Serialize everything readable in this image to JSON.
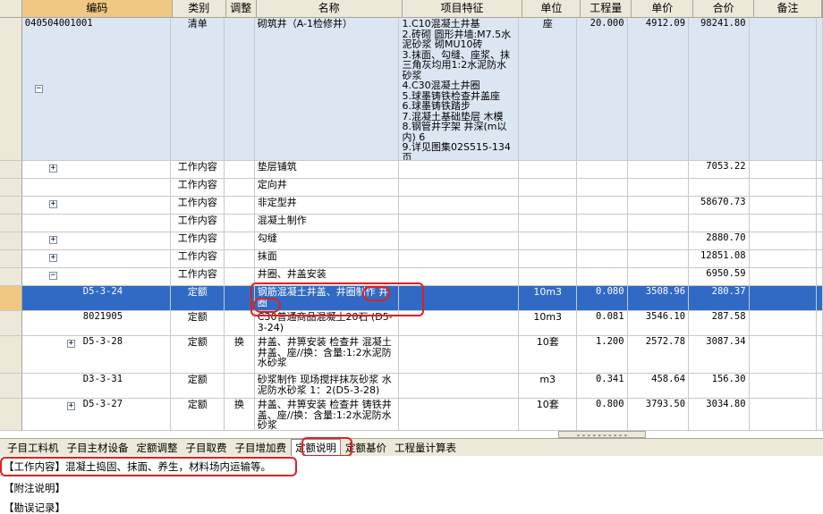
{
  "columns": {
    "code": "编码",
    "type": "类别",
    "adjust": "调整",
    "name": "名称",
    "features": "项目特征",
    "unit": "单位",
    "quantity": "工程量",
    "price": "单价",
    "total": "合价",
    "note": "备注"
  },
  "rows": [
    {
      "code": "040504001001",
      "type": "清单",
      "adjust": "",
      "name": "砌筑井（A-1检修井）",
      "features": "1.C10混凝土井基\n2.砖砌 圆形井墙:M7.5水泥砂浆 砌MU10砖\n3.抹面、勾缝、座浆、抹三角灰均用1:2水泥防水砂浆\n4.C30混凝土井圈\n5.球墨铸铁检查井盖座\n6.球墨铸铁踏步\n7.混凝土基础垫层 木模\n8.钢管井字架 井深(m以内) 6\n9.详见图集02S515-134页",
      "unit": "座",
      "quantity": "20.000",
      "price": "4912.09",
      "total": "98241.80",
      "expander": "−"
    },
    {
      "code": "",
      "type": "工作内容",
      "adjust": "",
      "name": "垫层铺筑",
      "features": "",
      "unit": "",
      "quantity": "",
      "price": "",
      "total": "7053.22",
      "expander": "+"
    },
    {
      "code": "",
      "type": "工作内容",
      "adjust": "",
      "name": "定向井",
      "features": "",
      "unit": "",
      "quantity": "",
      "price": "",
      "total": "",
      "expander": ""
    },
    {
      "code": "",
      "type": "工作内容",
      "adjust": "",
      "name": "非定型井",
      "features": "",
      "unit": "",
      "quantity": "",
      "price": "",
      "total": "58670.73",
      "expander": "+"
    },
    {
      "code": "",
      "type": "工作内容",
      "adjust": "",
      "name": "混凝土制作",
      "features": "",
      "unit": "",
      "quantity": "",
      "price": "",
      "total": "",
      "expander": ""
    },
    {
      "code": "",
      "type": "工作内容",
      "adjust": "",
      "name": "勾缝",
      "features": "",
      "unit": "",
      "quantity": "",
      "price": "",
      "total": "2880.70",
      "expander": "+"
    },
    {
      "code": "",
      "type": "工作内容",
      "adjust": "",
      "name": "抹面",
      "features": "",
      "unit": "",
      "quantity": "",
      "price": "",
      "total": "12851.08",
      "expander": "+"
    },
    {
      "code": "",
      "type": "工作内容",
      "adjust": "",
      "name": "井圈、井盖安装",
      "features": "",
      "unit": "",
      "quantity": "",
      "price": "",
      "total": "6950.59",
      "expander": "−"
    },
    {
      "code": "D5-3-24",
      "type": "定额",
      "adjust": "",
      "name": "钢筋混凝土井盖、井圈制作 井圈",
      "features": "",
      "unit": "10m3",
      "quantity": "0.080",
      "price": "3508.96",
      "total": "280.37",
      "expander": ""
    },
    {
      "code": "8021905",
      "type": "定额",
      "adjust": "",
      "name": "C30普通商品混凝土20石 (D5-3-24)",
      "features": "",
      "unit": "10m3",
      "quantity": "0.081",
      "price": "3546.10",
      "total": "287.58",
      "expander": ""
    },
    {
      "code": "D5-3-28",
      "type": "定额",
      "adjust": "换",
      "name": "井盖、井箅安装 检查井 混凝土井盖、座//换：含量:1:2水泥防水砂浆",
      "features": "",
      "unit": "10套",
      "quantity": "1.200",
      "price": "2572.78",
      "total": "3087.34",
      "expander": "+"
    },
    {
      "code": "D3-3-31",
      "type": "定额",
      "adjust": "",
      "name": "砂浆制作 现场搅拌抹灰砂浆 水泥防水砂浆 1：2(D5-3-28)",
      "features": "",
      "unit": "m3",
      "quantity": "0.341",
      "price": "458.64",
      "total": "156.30",
      "expander": ""
    },
    {
      "code": "D5-3-27",
      "type": "定额",
      "adjust": "换",
      "name": "井盖、井箅安装 检查井 铸铁井盖、座//换：含量:1:2水泥防水砂浆",
      "features": "",
      "unit": "10套",
      "quantity": "0.800",
      "price": "3793.50",
      "total": "3034.80",
      "expander": "+"
    }
  ],
  "tabs": [
    "子目工料机",
    "子目主材设备",
    "定额调整",
    "子目取费",
    "子目增加费",
    "定额说明",
    "定额基价",
    "工程量计算表"
  ],
  "active_tab": "定额说明",
  "description": {
    "work_content_label": "【工作内容】",
    "work_content": "混凝土捣固、抹面、养生，材料场内运输等。",
    "notes_label": "【附注说明】",
    "errata_label": "【勘误记录】"
  },
  "scroll_grip": "⌄⌄⌄⌄⌄⌄⌄⌄⌄⌄"
}
